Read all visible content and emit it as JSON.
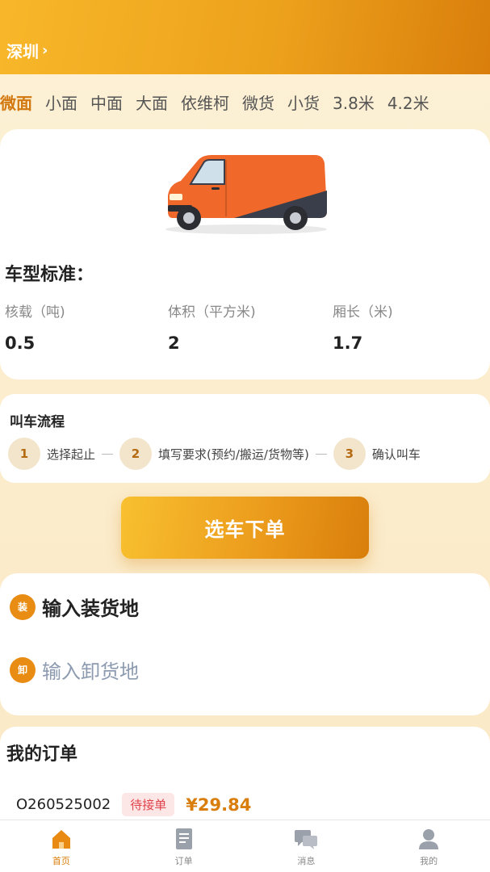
{
  "header": {
    "city": "深圳",
    "chevron": "›"
  },
  "vehicle_tabs": [
    {
      "label": "微面",
      "active": true
    },
    {
      "label": "小面",
      "active": false
    },
    {
      "label": "中面",
      "active": false
    },
    {
      "label": "大面",
      "active": false
    },
    {
      "label": "依维柯",
      "active": false
    },
    {
      "label": "微货",
      "active": false
    },
    {
      "label": "小货",
      "active": false
    },
    {
      "label": "3.8米",
      "active": false
    },
    {
      "label": "4.2米",
      "active": false
    }
  ],
  "vehicle": {
    "image_icon": "van-illustration",
    "standard_title": "车型标准：",
    "specs": [
      {
        "label": "核载（吨)",
        "value": "0.5"
      },
      {
        "label": "体积（平方米)",
        "value": "2"
      },
      {
        "label": "厢长（米)",
        "value": "1.7"
      }
    ]
  },
  "flow": {
    "title": "叫车流程",
    "steps": [
      {
        "num": "1",
        "text": "选择起止"
      },
      {
        "num": "2",
        "text": "填写要求(预约/搬运/货物等)"
      },
      {
        "num": "3",
        "text": "确认叫车"
      }
    ]
  },
  "cta": {
    "label": "选车下单"
  },
  "address": {
    "load_badge": "装",
    "load_placeholder": "输入装货地",
    "unload_badge": "卸",
    "unload_placeholder": "输入卸货地"
  },
  "orders": {
    "title": "我的订单",
    "items": [
      {
        "id": "O260525002",
        "status": "待接单",
        "price": "¥29.84"
      }
    ]
  },
  "tabbar": [
    {
      "label": "首页",
      "icon": "home-icon",
      "active": true
    },
    {
      "label": "订单",
      "icon": "order-icon",
      "active": false
    },
    {
      "label": "消息",
      "icon": "message-icon",
      "active": false
    },
    {
      "label": "我的",
      "icon": "profile-icon",
      "active": false
    }
  ],
  "colors": {
    "accent": "#d97e0c",
    "header_start": "#f8b72a",
    "status_red": "#e0424a"
  }
}
